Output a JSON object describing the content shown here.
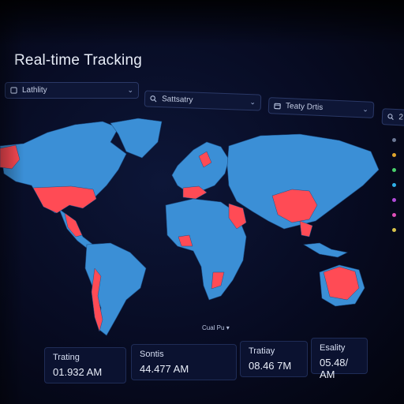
{
  "header": {
    "title": "Real-time Tracking"
  },
  "filters": [
    {
      "label": "Lathlity",
      "icon": "filter-icon"
    },
    {
      "label": "Sattsatry",
      "icon": "search-icon"
    },
    {
      "label": "Teaty Drtis",
      "icon": "calendar-icon"
    },
    {
      "label": "2",
      "icon": "search-icon"
    }
  ],
  "map": {
    "control_label": "Cual Pu",
    "highlight_color": "#ff4b55",
    "land_color": "#3b8fd6",
    "background_color": "#0a0f2c"
  },
  "legend_colors": [
    "#6b7894",
    "#e0a52c",
    "#49d06b",
    "#2fb1e8",
    "#b04ad8",
    "#e04fb8",
    "#d8c34a"
  ],
  "stats": [
    {
      "label": "Trating",
      "value": "01.932 AM"
    },
    {
      "label": "Sontis",
      "value": "44.477 AM"
    },
    {
      "label": "Tratiay",
      "value": "08.46 7M"
    },
    {
      "label": "Esality",
      "value": "05.48/ AM"
    }
  ]
}
